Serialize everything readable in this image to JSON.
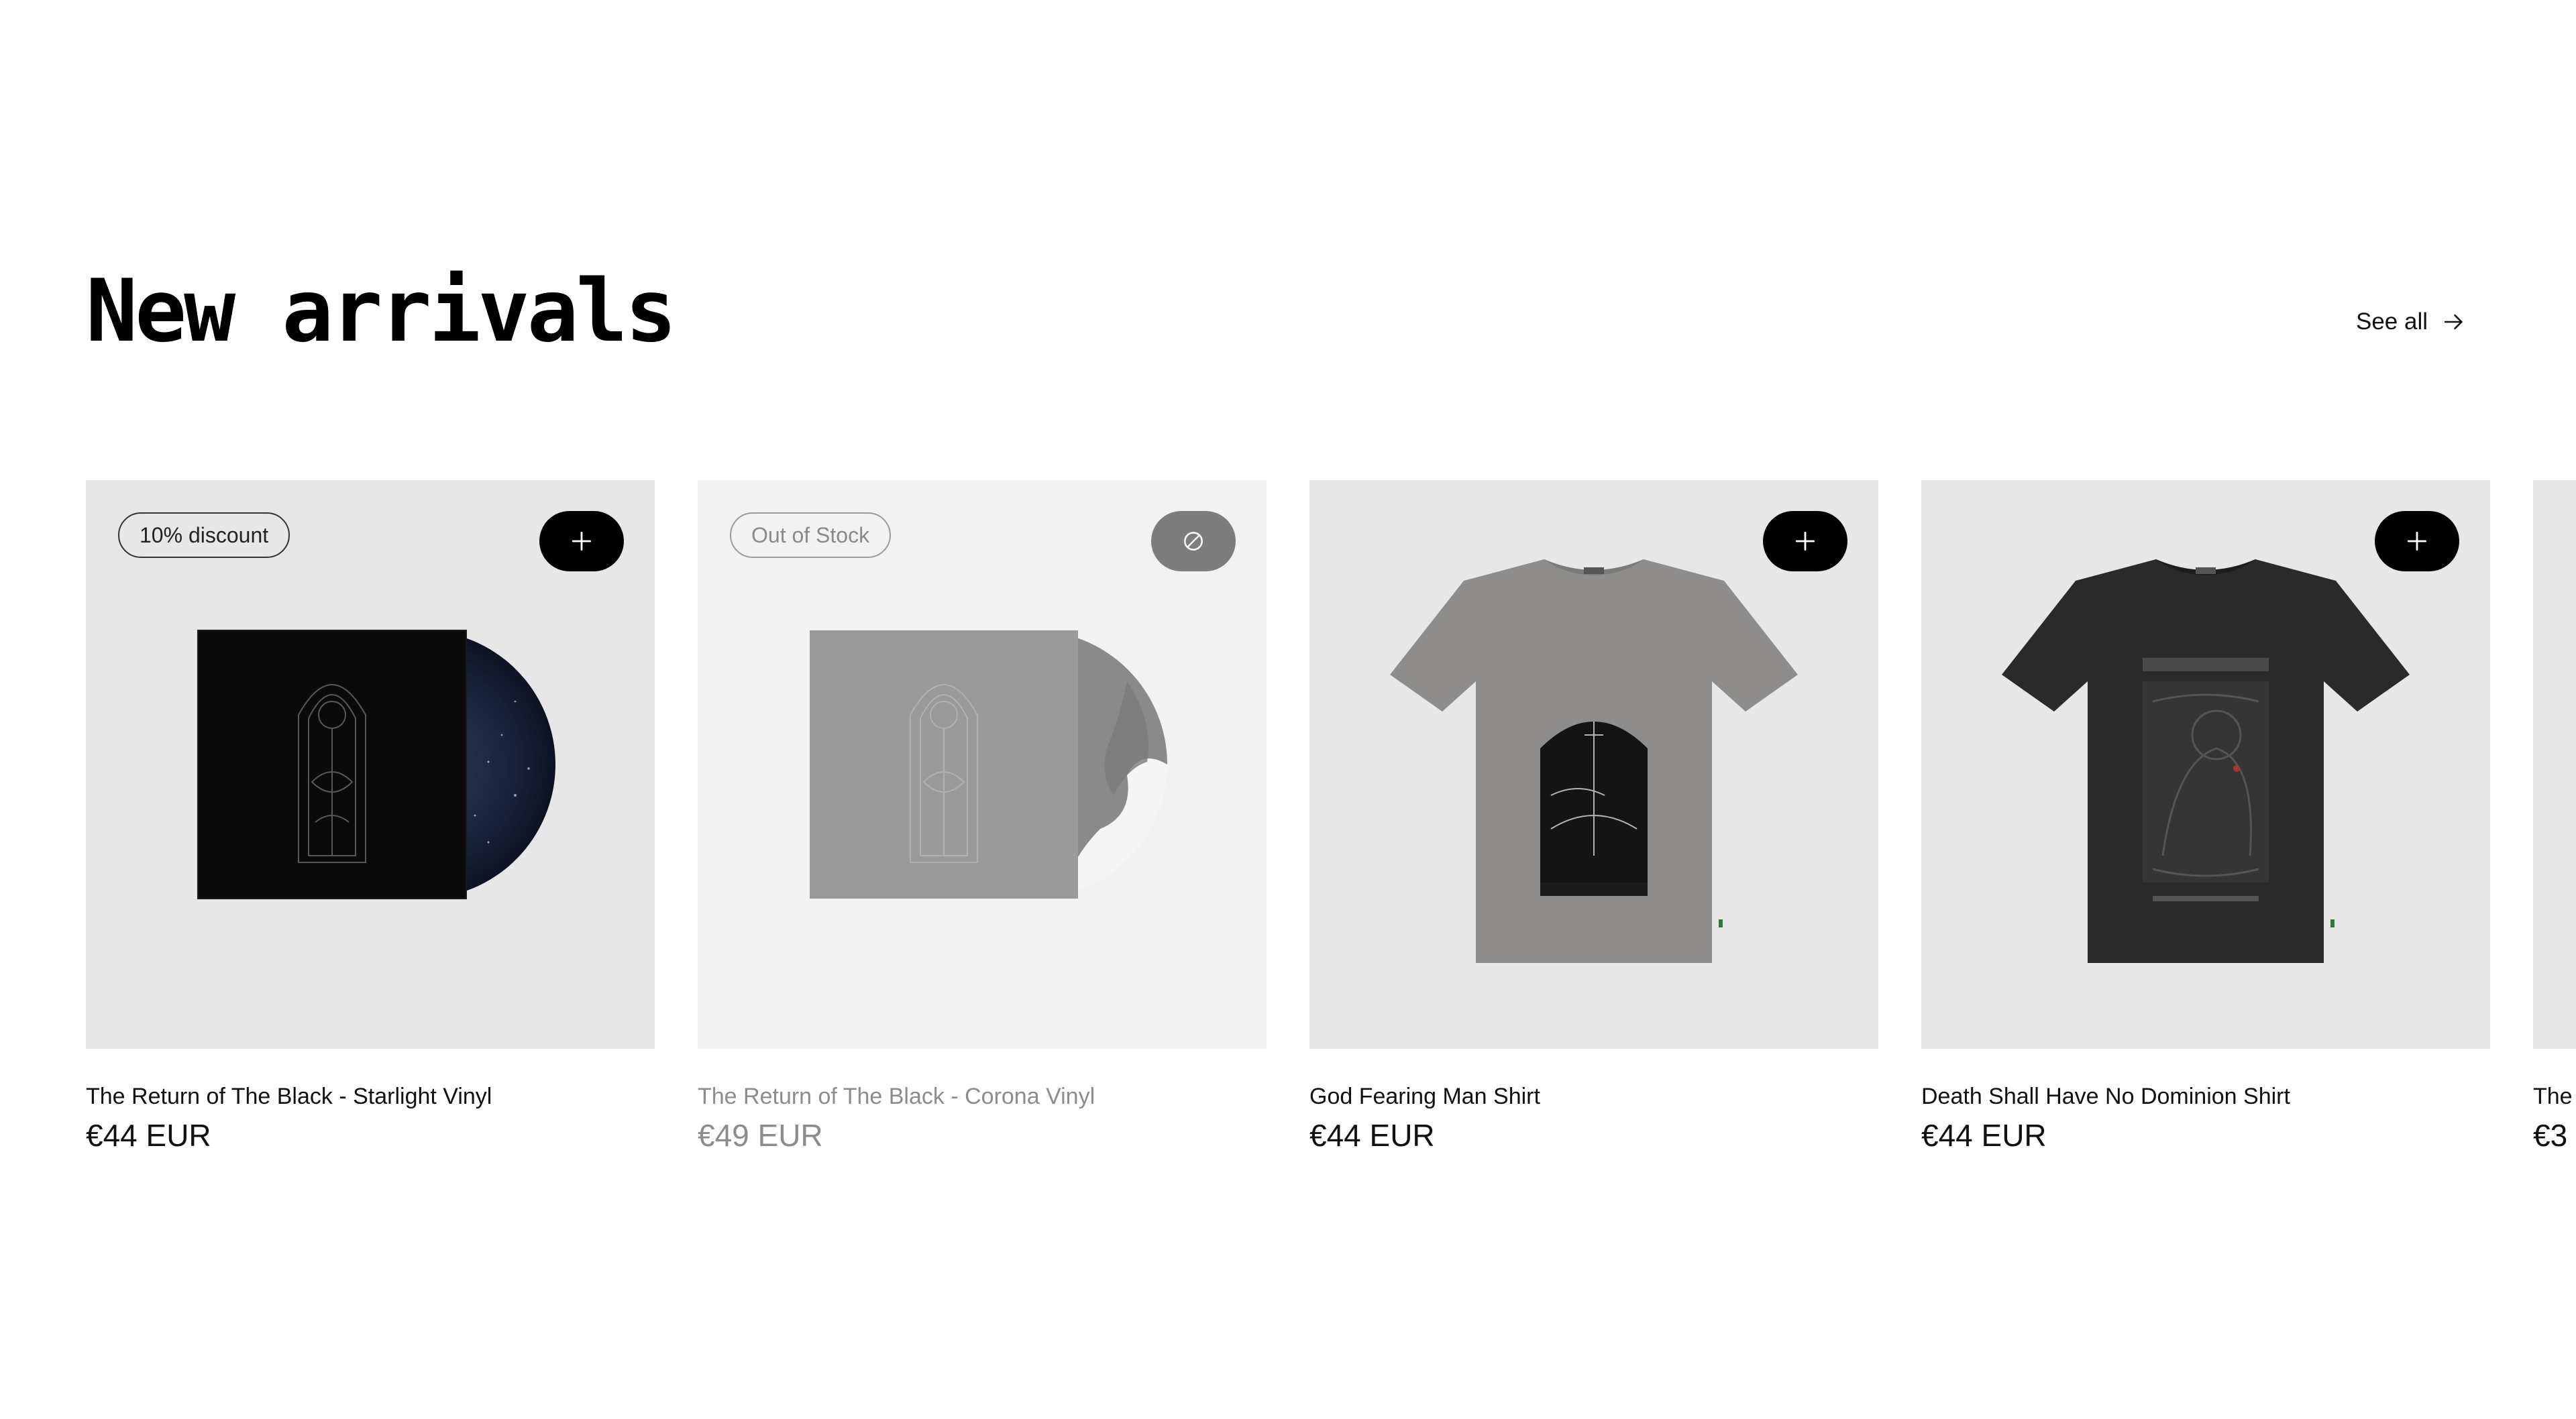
{
  "section": {
    "title": "New arrivals",
    "see_all_label": "See all"
  },
  "products": [
    {
      "name": "The Return of The Black - Starlight Vinyl",
      "price": "€44 EUR",
      "badge": "10% discount",
      "action_icon": "plus-icon",
      "in_stock": true
    },
    {
      "name": "The Return of The Black - Corona Vinyl",
      "price": "€49 EUR",
      "badge": "Out of Stock",
      "action_icon": "unavailable-icon",
      "in_stock": false
    },
    {
      "name": "God Fearing Man Shirt",
      "price": "€44 EUR",
      "action_icon": "plus-icon",
      "in_stock": true
    },
    {
      "name": "Death Shall Have No Dominion Shirt",
      "price": "€44 EUR",
      "action_icon": "plus-icon",
      "in_stock": true
    },
    {
      "name": "The",
      "price": "€3",
      "in_stock": true
    }
  ],
  "colors": {
    "tile_background": "#e7e7e7",
    "tile_background_out_of_stock": "#f2f2f2",
    "button_background": "#000000",
    "button_disabled": "#7d7d7d",
    "muted_text": "#8c8c8c"
  }
}
